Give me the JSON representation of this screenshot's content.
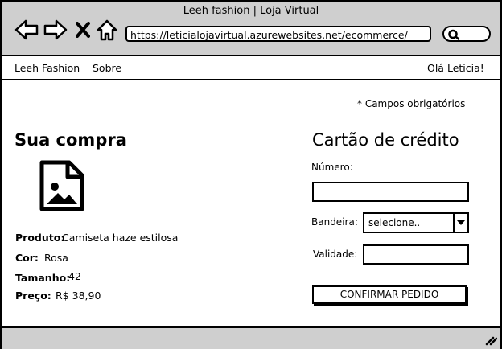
{
  "window": {
    "title": "Leeh fashion | Loja Virtual",
    "url": "https://leticialojavirtual.azurewebsites.net/ecommerce/",
    "search_placeholder": ""
  },
  "nav_icons": [
    "back-arrow-icon",
    "forward-arrow-icon",
    "close-x-icon",
    "home-icon",
    "search-icon"
  ],
  "menu": {
    "brand": "Leeh Fashion",
    "about": "Sobre",
    "greeting": "Olá Leticia!"
  },
  "page": {
    "required_note": "* Campos obrigatórios"
  },
  "purchase": {
    "title": "Sua compra",
    "image_icon": "image-icon",
    "product_label": "Produto:",
    "product_value": "Camiseta haze estilosa",
    "color_label": "Cor:",
    "color_value": "Rosa",
    "size_label": "Tamanho:",
    "size_value": "42",
    "price_label": "Preço:",
    "price_value": "R$ 38,90"
  },
  "card": {
    "title": "Cartão de crédito",
    "number_label": "Número:",
    "number_value": "",
    "brand_label": "Bandeira:",
    "brand_selected": "selecione..",
    "expiry_label": "Validade:",
    "expiry_value": "",
    "confirm_label": "CONFIRMAR PEDIDO"
  },
  "colors": {
    "chrome_gray": "#cfcfcf",
    "border": "#000000",
    "background": "#ffffff"
  }
}
